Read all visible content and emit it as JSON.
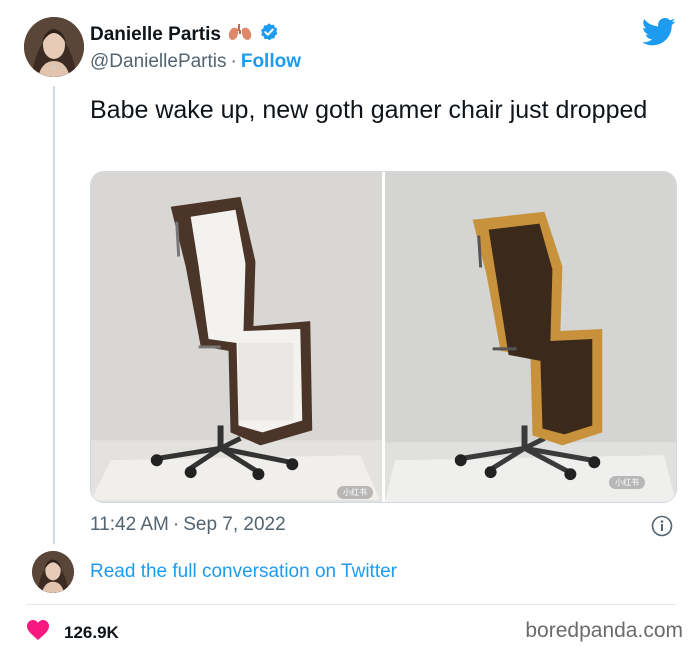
{
  "author": {
    "display_name": "Danielle Partis",
    "handle": "@DaniellePartis",
    "separator": "·",
    "follow_label": "Follow"
  },
  "tweet": {
    "text": "Babe wake up, new goth gamer chair just dropped",
    "time": "11:42 AM",
    "date": "Sep 7, 2022",
    "separator": "·",
    "image_watermark_left": "小红书",
    "image_watermark_right": "小红书"
  },
  "footer": {
    "read_more": "Read the full conversation on Twitter",
    "like_count": "126.9K",
    "source": "boredpanda.com"
  },
  "colors": {
    "link_blue": "#1d9bf0",
    "heart_red": "#f91880",
    "text_dark": "#0f1419",
    "text_gray": "#536471"
  },
  "icons": [
    "avatar",
    "lungs-emoji-icon",
    "verified-badge-icon",
    "twitter-bird-icon",
    "info-icon",
    "heart-icon"
  ]
}
